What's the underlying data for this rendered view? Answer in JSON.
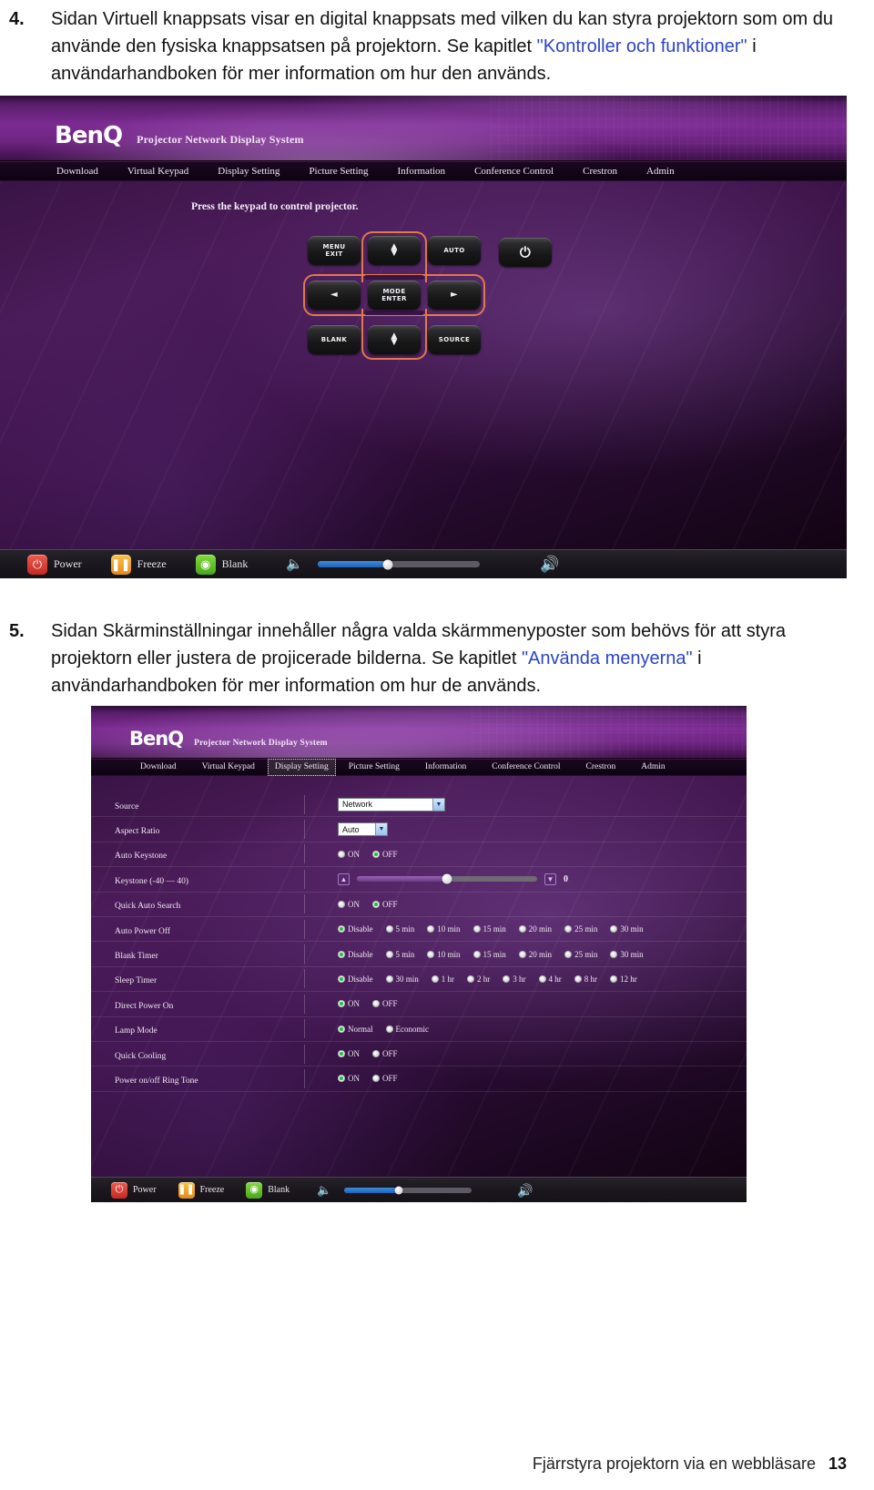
{
  "doc": {
    "item4": {
      "number": "4.",
      "text_1": "Sidan Virtuell knappsats visar en digital knappsats med vilken du kan styra projektorn som om du använde den fysiska knappsatsen på projektorn. Se kapitlet ",
      "link": "\"Kontroller och funktioner\"",
      "text_2": " i användarhandboken för mer information om hur den används."
    },
    "item5": {
      "number": "5.",
      "text_1": "Sidan Skärminställningar innehåller några valda skärmmenyposter som behövs för att styra projektorn eller justera de projicerade bilderna. Se kapitlet ",
      "link": "\"Använda menyerna\"",
      "text_2": " i användarhandboken för mer information om hur de används."
    }
  },
  "footer": {
    "text": "Fjärrstyra projektorn via en webbläsare",
    "page": "13"
  },
  "benq": {
    "logo": "BenQ",
    "subtitle": "Projector Network Display System",
    "nav": [
      "Download",
      "Virtual Keypad",
      "Display Setting",
      "Picture Setting",
      "Information",
      "Conference Control",
      "Crestron",
      "Admin"
    ],
    "bottom_bar": {
      "power_label": "Power",
      "power_icon": "power-icon",
      "freeze_label": "Freeze",
      "freeze_icon": "pause-icon",
      "blank_label": "Blank",
      "blank_icon": "blank-screen-icon",
      "mute_icon": "speaker-mute-icon",
      "volume_icon": "speaker-volume-icon",
      "volume_percent": 43
    },
    "colors": {
      "power_button": "#d9392f",
      "freeze_button": "#efa022",
      "blank_button": "#5ec12a",
      "volume_fill": "#2f7fd8",
      "header_purple": "#7c2b92",
      "keypad_highlight": "#e0794a"
    }
  },
  "keypad_page": {
    "hint": "Press the keypad to control projector.",
    "buttons": {
      "menu_exit": "MENU\nEXIT",
      "menu": "MENU",
      "exit": "EXIT",
      "up": "▲▼",
      "auto": "AUTO",
      "power": "⏻",
      "left": "◄",
      "mode": "MODE",
      "enter": "ENTER",
      "right": "►",
      "blank": "BLANK",
      "down": "▲▼",
      "source": "SOURCE"
    }
  },
  "display_setting": {
    "selected_tab": "Display Setting",
    "rows": [
      {
        "label": "Source",
        "type": "select",
        "value": "Network",
        "width": 118
      },
      {
        "label": "Aspect Ratio",
        "type": "select",
        "value": "Auto",
        "width": 55
      },
      {
        "label": "Auto Keystone",
        "type": "radio",
        "options": [
          "ON",
          "OFF"
        ],
        "selected": 1
      },
      {
        "label": "Keystone (-40 — 40)",
        "type": "slider",
        "value": "0",
        "percent": 50,
        "dec_icon": "keystone-decrease-icon",
        "inc_icon": "keystone-increase-icon"
      },
      {
        "label": "Quick Auto Search",
        "type": "radio",
        "options": [
          "ON",
          "OFF"
        ],
        "selected": 1
      },
      {
        "label": "Auto Power Off",
        "type": "radio",
        "options": [
          "Disable",
          "5 min",
          "10 min",
          "15 min",
          "20 min",
          "25 min",
          "30 min"
        ],
        "selected": 0
      },
      {
        "label": "Blank Timer",
        "type": "radio",
        "options": [
          "Disable",
          "5 min",
          "10 min",
          "15 min",
          "20 min",
          "25 min",
          "30 min"
        ],
        "selected": 0
      },
      {
        "label": "Sleep Timer",
        "type": "radio",
        "options": [
          "Disable",
          "30 min",
          "1 hr",
          "2 hr",
          "3 hr",
          "4 hr",
          "8 hr",
          "12 hr"
        ],
        "selected": 0
      },
      {
        "label": "Direct Power On",
        "type": "radio",
        "options": [
          "ON",
          "OFF"
        ],
        "selected": 0
      },
      {
        "label": "Lamp Mode",
        "type": "radio",
        "options": [
          "Normal",
          "Economic"
        ],
        "selected": 0
      },
      {
        "label": "Quick Cooling",
        "type": "radio",
        "options": [
          "ON",
          "OFF"
        ],
        "selected": 0
      },
      {
        "label": "Power on/off Ring Tone",
        "type": "radio",
        "options": [
          "ON",
          "OFF"
        ],
        "selected": 0
      }
    ]
  }
}
